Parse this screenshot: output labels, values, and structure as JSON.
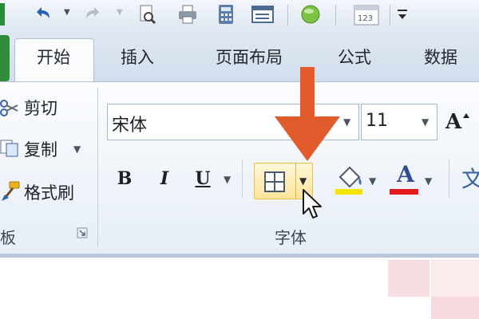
{
  "quick_access": {
    "icons": [
      "undo-icon",
      "redo-icon",
      "print-preview-icon",
      "print-icon",
      "calculator-icon",
      "form-icon",
      "circle-icon",
      "calendar-icon",
      "customize-icon"
    ],
    "calendar_number": "123"
  },
  "tabs": [
    "开始",
    "插入",
    "页面布局",
    "公式",
    "数据"
  ],
  "active_tab": "开始",
  "clipboard": {
    "cut_label": "剪切",
    "copy_label": "复制",
    "format_painter_label": "格式刷",
    "group_label_partial": "板"
  },
  "font_group": {
    "font_name": "宋体",
    "font_size": "11",
    "bold_label": "B",
    "italic_label": "I",
    "underline_label": "U",
    "grow_font_label": "A",
    "font_color_label": "A",
    "group_label": "字体"
  },
  "colors": {
    "highlight": "#f5e400",
    "font_color": "#e41c1c",
    "annotation_arrow": "#e25b2c",
    "accent_border": "#e8c24a"
  }
}
